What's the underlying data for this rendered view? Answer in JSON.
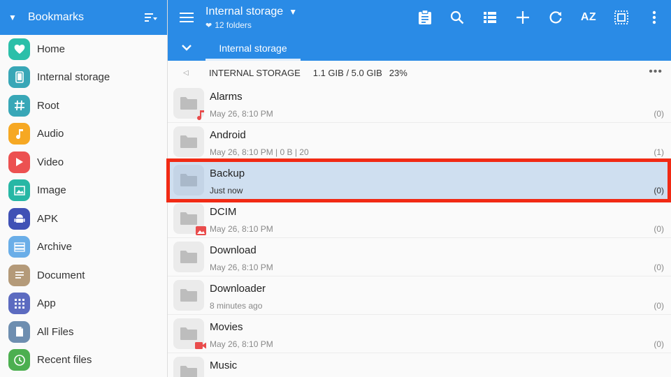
{
  "colors": {
    "accent": "#2a8be6",
    "highlight": "#f12a14",
    "selected_row": "#cfdff0"
  },
  "sidebar": {
    "title": "Bookmarks",
    "items": [
      {
        "label": "Home",
        "icon": "heart-icon",
        "color": "#2bbfa9"
      },
      {
        "label": "Internal storage",
        "icon": "phone-icon",
        "color": "#38a7b7"
      },
      {
        "label": "Root",
        "icon": "hash-icon",
        "color": "#38a7b7"
      },
      {
        "label": "Audio",
        "icon": "music-note-icon",
        "color": "#f6a823"
      },
      {
        "label": "Video",
        "icon": "play-icon",
        "color": "#ec5151"
      },
      {
        "label": "Image",
        "icon": "image-icon",
        "color": "#27b7a5"
      },
      {
        "label": "APK",
        "icon": "android-icon",
        "color": "#3f51b5"
      },
      {
        "label": "Archive",
        "icon": "archive-icon",
        "color": "#6aaee8"
      },
      {
        "label": "Document",
        "icon": "document-icon",
        "color": "#b49a79"
      },
      {
        "label": "App",
        "icon": "app-grid-icon",
        "color": "#5c6bc0"
      },
      {
        "label": "All Files",
        "icon": "file-icon",
        "color": "#6e8eb0"
      },
      {
        "label": "Recent files",
        "icon": "clock-icon",
        "color": "#4caf50"
      }
    ]
  },
  "topbar": {
    "title": "Internal storage",
    "subtitle": "12 folders",
    "az_label": "AZ"
  },
  "tabs": [
    {
      "label": "Internal storage"
    }
  ],
  "path": {
    "name": "INTERNAL STORAGE",
    "size": "1.1 GIB / 5.0 GIB",
    "percent": "23%"
  },
  "files": [
    {
      "name": "Alarms",
      "meta": "May 26, 8:10 PM",
      "count": "(0)",
      "badge": "music-note-icon"
    },
    {
      "name": "Android",
      "meta": "May 26, 8:10 PM | 0 B | 20",
      "count": "(1)",
      "badge": ""
    },
    {
      "name": "Backup",
      "meta": "Just now",
      "count": "(0)",
      "badge": "",
      "selected": true
    },
    {
      "name": "DCIM",
      "meta": "May 26, 8:10 PM",
      "count": "(0)",
      "badge": "image-icon"
    },
    {
      "name": "Download",
      "meta": "May 26, 8:10 PM",
      "count": "(0)",
      "badge": ""
    },
    {
      "name": "Downloader",
      "meta": "8 minutes ago",
      "count": "(0)",
      "badge": ""
    },
    {
      "name": "Movies",
      "meta": "May 26, 8:10 PM",
      "count": "(0)",
      "badge": "video-camera-icon"
    },
    {
      "name": "Music",
      "meta": "",
      "count": "",
      "badge": ""
    }
  ]
}
